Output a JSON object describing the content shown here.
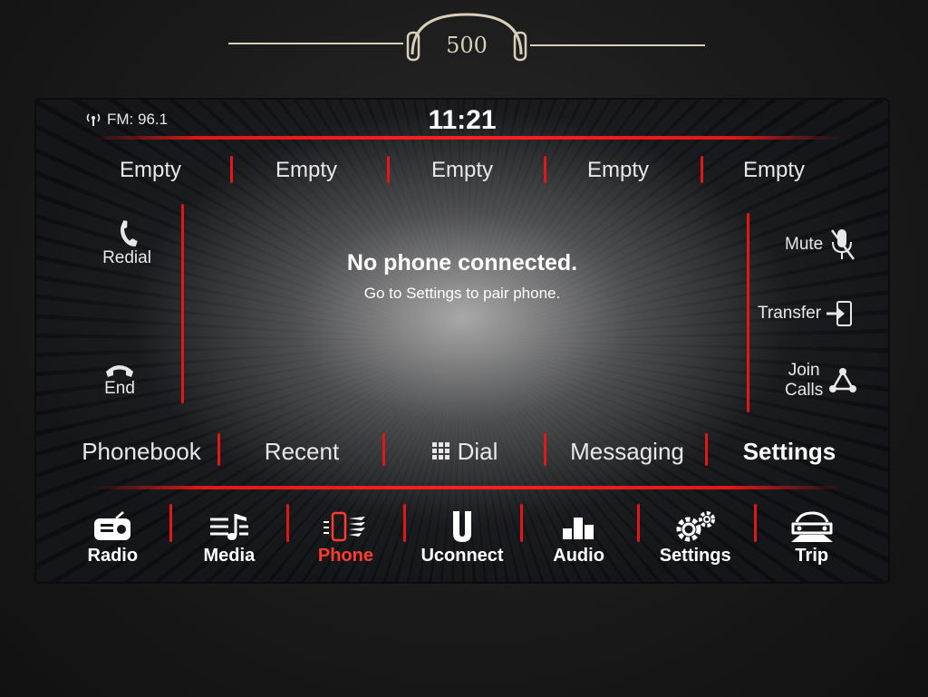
{
  "status": {
    "radio": "FM: 96.1",
    "clock": "11:21"
  },
  "presets": [
    "Empty",
    "Empty",
    "Empty",
    "Empty",
    "Empty"
  ],
  "left_controls": {
    "redial": "Redial",
    "end": "End"
  },
  "right_controls": {
    "mute": "Mute",
    "transfer": "Transfer",
    "join_calls_line1": "Join",
    "join_calls_line2": "Calls"
  },
  "message": {
    "title": "No phone connected.",
    "subtitle": "Go to Settings to pair phone."
  },
  "phone_tabs": [
    "Phonebook",
    "Recent",
    "Dial",
    "Messaging",
    "Settings"
  ],
  "phone_tab_selected": "Settings",
  "main_nav": [
    {
      "label": "Radio",
      "icon": "radio-icon"
    },
    {
      "label": "Media",
      "icon": "media-icon"
    },
    {
      "label": "Phone",
      "icon": "phone-icon",
      "active": true
    },
    {
      "label": "Uconnect",
      "icon": "uconnect-icon"
    },
    {
      "label": "Audio",
      "icon": "audio-icon"
    },
    {
      "label": "Settings",
      "icon": "settings-icon"
    },
    {
      "label": "Trip",
      "icon": "trip-icon"
    }
  ],
  "colors": {
    "accent_red": "#e01818",
    "active_text": "#ff3b2f",
    "text": "#e8e8e8",
    "background": "#151619"
  }
}
